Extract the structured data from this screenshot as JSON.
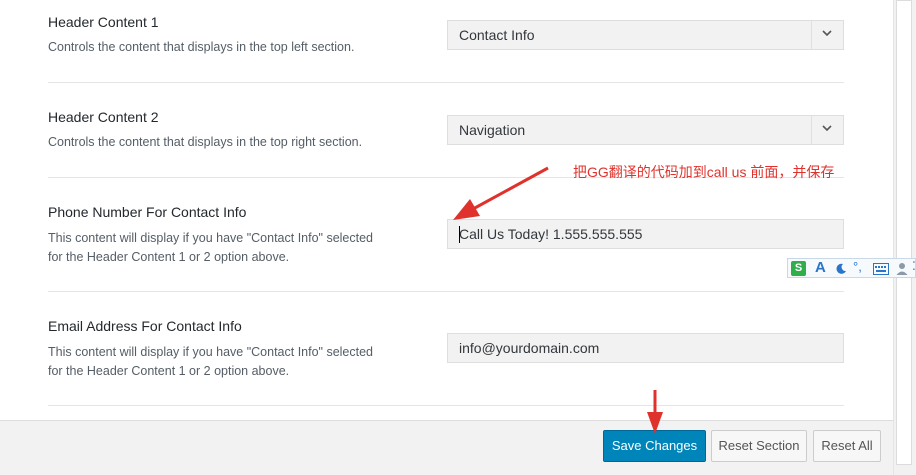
{
  "settings": {
    "header_content_1": {
      "title": "Header Content 1",
      "description": "Controls the content that displays in the top left section.",
      "selected": "Contact Info"
    },
    "header_content_2": {
      "title": "Header Content 2",
      "description": "Controls the content that displays in the top right section.",
      "selected": "Navigation"
    },
    "phone_number": {
      "title": "Phone Number For Contact Info",
      "description_line1": "This content will display if you have \"Contact Info\" selected",
      "description_line2": "for the Header Content 1 or 2 option above.",
      "value": "Call Us Today! 1.555.555.555"
    },
    "email_address": {
      "title": "Email Address For Contact Info",
      "description_line1": "This content will display if you have \"Contact Info\" selected",
      "description_line2": "for the Header Content 1 or 2 option above.",
      "value": "info@yourdomain.com"
    }
  },
  "annotation": {
    "text": "把GG翻译的代码加到call us 前面，并保存",
    "color": "#e0322c"
  },
  "ime_toolbar": {
    "logo": "S",
    "mode": "A",
    "punct": "°,"
  },
  "footer": {
    "save_label": "Save Changes",
    "reset_section_label": "Reset Section",
    "reset_all_label": "Reset All"
  },
  "colors": {
    "primary": "#0085ba",
    "annotation_red": "#e0322c"
  },
  "icons": [
    "chevron-down-icon",
    "ime-logo-icon",
    "half-width-moon-icon",
    "keyboard-icon",
    "user-icon",
    "red-arrow"
  ]
}
